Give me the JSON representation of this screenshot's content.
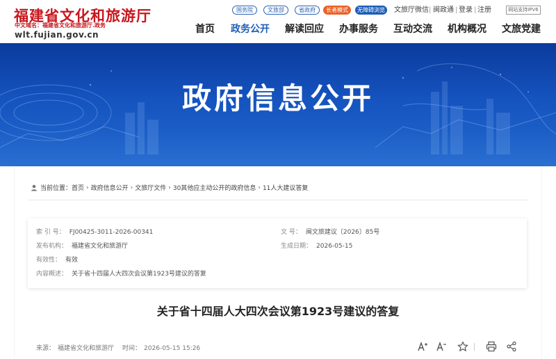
{
  "header": {
    "site_title": "福建省文化和旅游厅",
    "domain_line": "中文域名：福建省文化和旅游厅.政务",
    "url": "wlt.fujian.gov.cn",
    "quick_links": [
      "国务院",
      "文旅部",
      "省政府"
    ],
    "mode_buttons": [
      "长者模式",
      "无障碍浏览"
    ],
    "top_links": [
      "文旅厅微信",
      "闽政通",
      "登录",
      "注册"
    ],
    "ipv6_badge": "网站支持IPV6",
    "nav": [
      "首页",
      "政务公开",
      "解读回应",
      "办事服务",
      "互动交流",
      "机构概况",
      "文旅党建"
    ],
    "nav_active": "政务公开"
  },
  "banner": {
    "title": "政府信息公开"
  },
  "breadcrumb": {
    "prefix": "当前位置：",
    "items": [
      "首页",
      "政府信息公开",
      "文旅厅文件",
      "30其他应主动公开的政府信息",
      "11人大建议答复"
    ],
    "separator": "›"
  },
  "meta": {
    "index_label": "索 引 号：",
    "index_value": "FJ00425-3011-2026-00341",
    "docno_label": "文 号：",
    "docno_value": "闽文旅建议〔2026〕85号",
    "org_label": "发布机构：",
    "org_value": "福建省文化和旅游厅",
    "date_label": "生成日期：",
    "date_value": "2026-05-15",
    "validity_label": "有效性：",
    "validity_value": "有效",
    "summary_label": "内容概述：",
    "summary_value": "关于省十四届人大四次会议第1923号建议的答复"
  },
  "article": {
    "title": "关于省十四届人大四次会议第1923号建议的答复",
    "source_label": "来源：",
    "source_value": "福建省文化和旅游厅",
    "time_label": "时间：",
    "time_value": "2026-05-15 15:26"
  },
  "tools": [
    "font-increase-icon",
    "font-decrease-icon",
    "favorite-icon",
    "print-icon",
    "share-icon"
  ],
  "colors": {
    "brand_red": "#c8161d",
    "gov_blue": "#1e5db8",
    "elder_orange": "#e8632b"
  }
}
